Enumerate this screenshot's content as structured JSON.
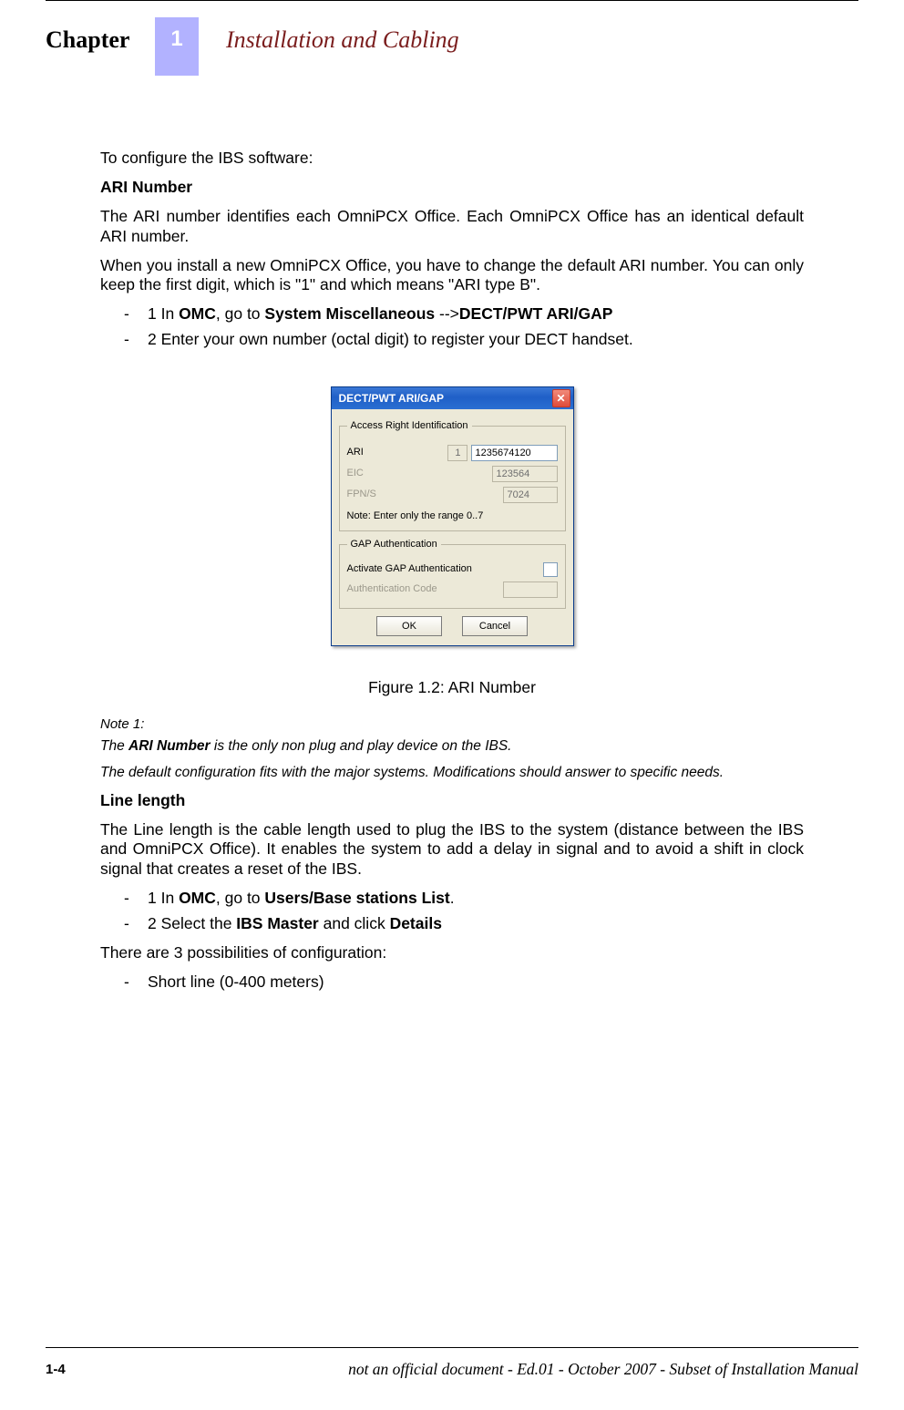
{
  "header": {
    "chapter_label": "Chapter",
    "chapter_number": "1",
    "chapter_title": "Installation and Cabling"
  },
  "body": {
    "intro": "To configure the IBS software:",
    "h_ari": "ARI Number",
    "ari_p1": "The ARI number identifies each OmniPCX Office. Each OmniPCX Office has an identical default ARI number.",
    "ari_p2": "When you install a new OmniPCX Office, you have to change the default ARI number. You can only keep the first digit, which is \"1\" and which means \"ARI type B\".",
    "ari_step1_pre": "1 In ",
    "ari_step1_omc": "OMC",
    "ari_step1_mid": ", go to ",
    "ari_step1_sys": "System Miscellaneous",
    "ari_step1_arrow": " --&gt;",
    "ari_step1_menu": "DECT/PWT ARI/GAP",
    "ari_step2": "2 Enter your own number (octal digit) to register your DECT handset.",
    "fig_caption": "Figure 1.2: ARI Number",
    "note_hdr": "Note 1:",
    "note_p1_pre": "The ",
    "note_p1_b": "ARI Number",
    "note_p1_post": " is the only non plug and play device on the IBS.",
    "note_p2": "The default configuration fits with the major systems. Modifications should answer to specific needs.",
    "h_line": "Line length",
    "line_p1": "The Line length is the cable length used to plug the IBS to the system (distance between the IBS and OmniPCX Office). It enables the system to add a delay in signal and to avoid a shift in clock signal that creates a reset of the IBS.",
    "line_step1_pre": "1 In ",
    "line_step1_omc": "OMC",
    "line_step1_mid": ", go to ",
    "line_step1_menu": "Users/Base stations List",
    "line_step1_post": ".",
    "line_step2_pre": "2 Select the ",
    "line_step2_b1": "IBS Master",
    "line_step2_mid": " and click ",
    "line_step2_b2": "Details",
    "line_p2": "There are 3 possibilities of configuration:",
    "line_opt1": "Short line (0-400 meters)"
  },
  "dialog": {
    "title": "DECT/PWT ARI/GAP",
    "grp_ari": "Access Right Identification",
    "lbl_ari": "ARI",
    "ari_prefix": "1",
    "ari_value": "1235674120",
    "lbl_eic": "EIC",
    "eic_value": "123564",
    "lbl_fpns": "FPN/S",
    "fpns_value": "7024",
    "range_note": "Note: Enter only the range 0..7",
    "grp_gap": "GAP Authentication",
    "lbl_act": "Activate GAP Authentication",
    "lbl_auth": "Authentication Code",
    "btn_ok": "OK",
    "btn_cancel": "Cancel"
  },
  "footer": {
    "page_number": "1-4",
    "footer_text": "not an official document - Ed.01 - October 2007 - Subset of Installation Manual"
  }
}
